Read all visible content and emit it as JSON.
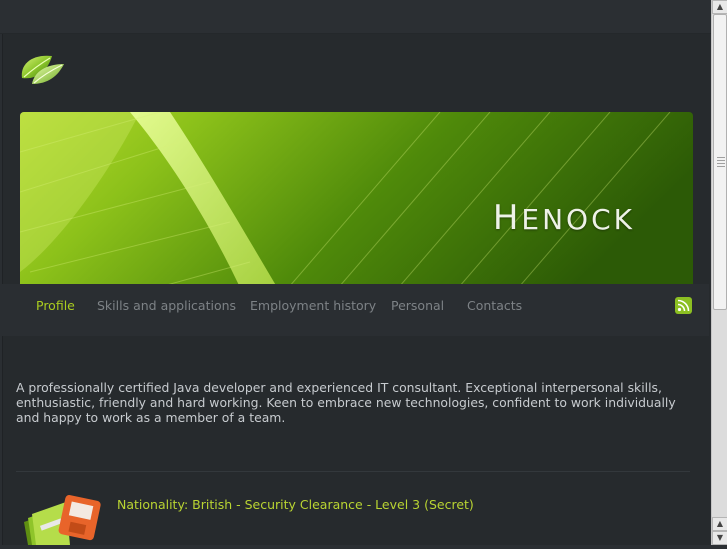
{
  "brand": {
    "logo_icon": "leaf-logo-icon"
  },
  "banner": {
    "title": "Henock"
  },
  "nav": {
    "items": [
      {
        "label": "Profile",
        "active": true
      },
      {
        "label": "Skills and applications",
        "active": false
      },
      {
        "label": "Employment history",
        "active": false
      },
      {
        "label": "Personal",
        "active": false
      },
      {
        "label": "Contacts",
        "active": false
      }
    ],
    "rss_icon": "rss-icon"
  },
  "profile": {
    "intro": "A professionally certified Java developer and experienced IT consultant. Exceptional interpersonal skills, enthusiastic, friendly and hard working. Keen to embrace new technologies, confident to work individually and happy to work as a member of a team.",
    "items": [
      {
        "icon": "documents-folder-icon",
        "text": "Nationality: British - Security Clearance - Level 3 (Secret)"
      }
    ]
  },
  "colors": {
    "accent": "#a9cc1f",
    "background": "#262a2d",
    "nav_text": "#7d8286"
  }
}
